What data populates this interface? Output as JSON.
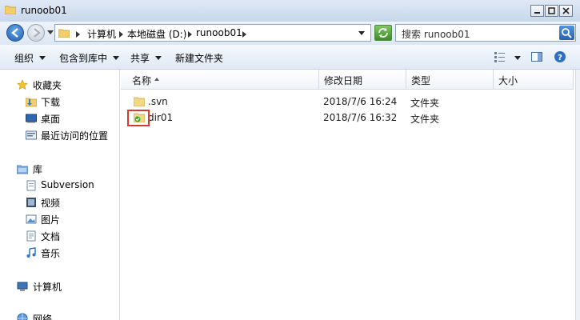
{
  "window": {
    "title": "runoob01"
  },
  "address": {
    "crumbs": [
      "计算机",
      "本地磁盘 (D:)",
      "runoob01"
    ]
  },
  "search": {
    "placeholder": "搜索 runoob01"
  },
  "toolbar": {
    "organize": "组织",
    "include_in_library": "包含到库中",
    "share": "共享",
    "new_folder": "新建文件夹"
  },
  "sidebar": {
    "favorites": {
      "label": "收藏夹",
      "items": [
        "下载",
        "桌面",
        "最近访问的位置"
      ]
    },
    "libraries": {
      "label": "库",
      "items": [
        "Subversion",
        "视频",
        "图片",
        "文档",
        "音乐"
      ]
    },
    "computer": "计算机",
    "network": "网络"
  },
  "columns": {
    "name": "名称",
    "modified": "修改日期",
    "type": "类型",
    "size": "大小"
  },
  "files": [
    {
      "name": ".svn",
      "modified": "2018/7/6 16:24",
      "type": "文件夹",
      "size": ""
    },
    {
      "name": "dir01",
      "modified": "2018/7/6 16:32",
      "type": "文件夹",
      "size": ""
    }
  ],
  "colors": {
    "highlight": "#d93a2e",
    "folder": "#f2cf6a",
    "accent": "#2663b3"
  }
}
